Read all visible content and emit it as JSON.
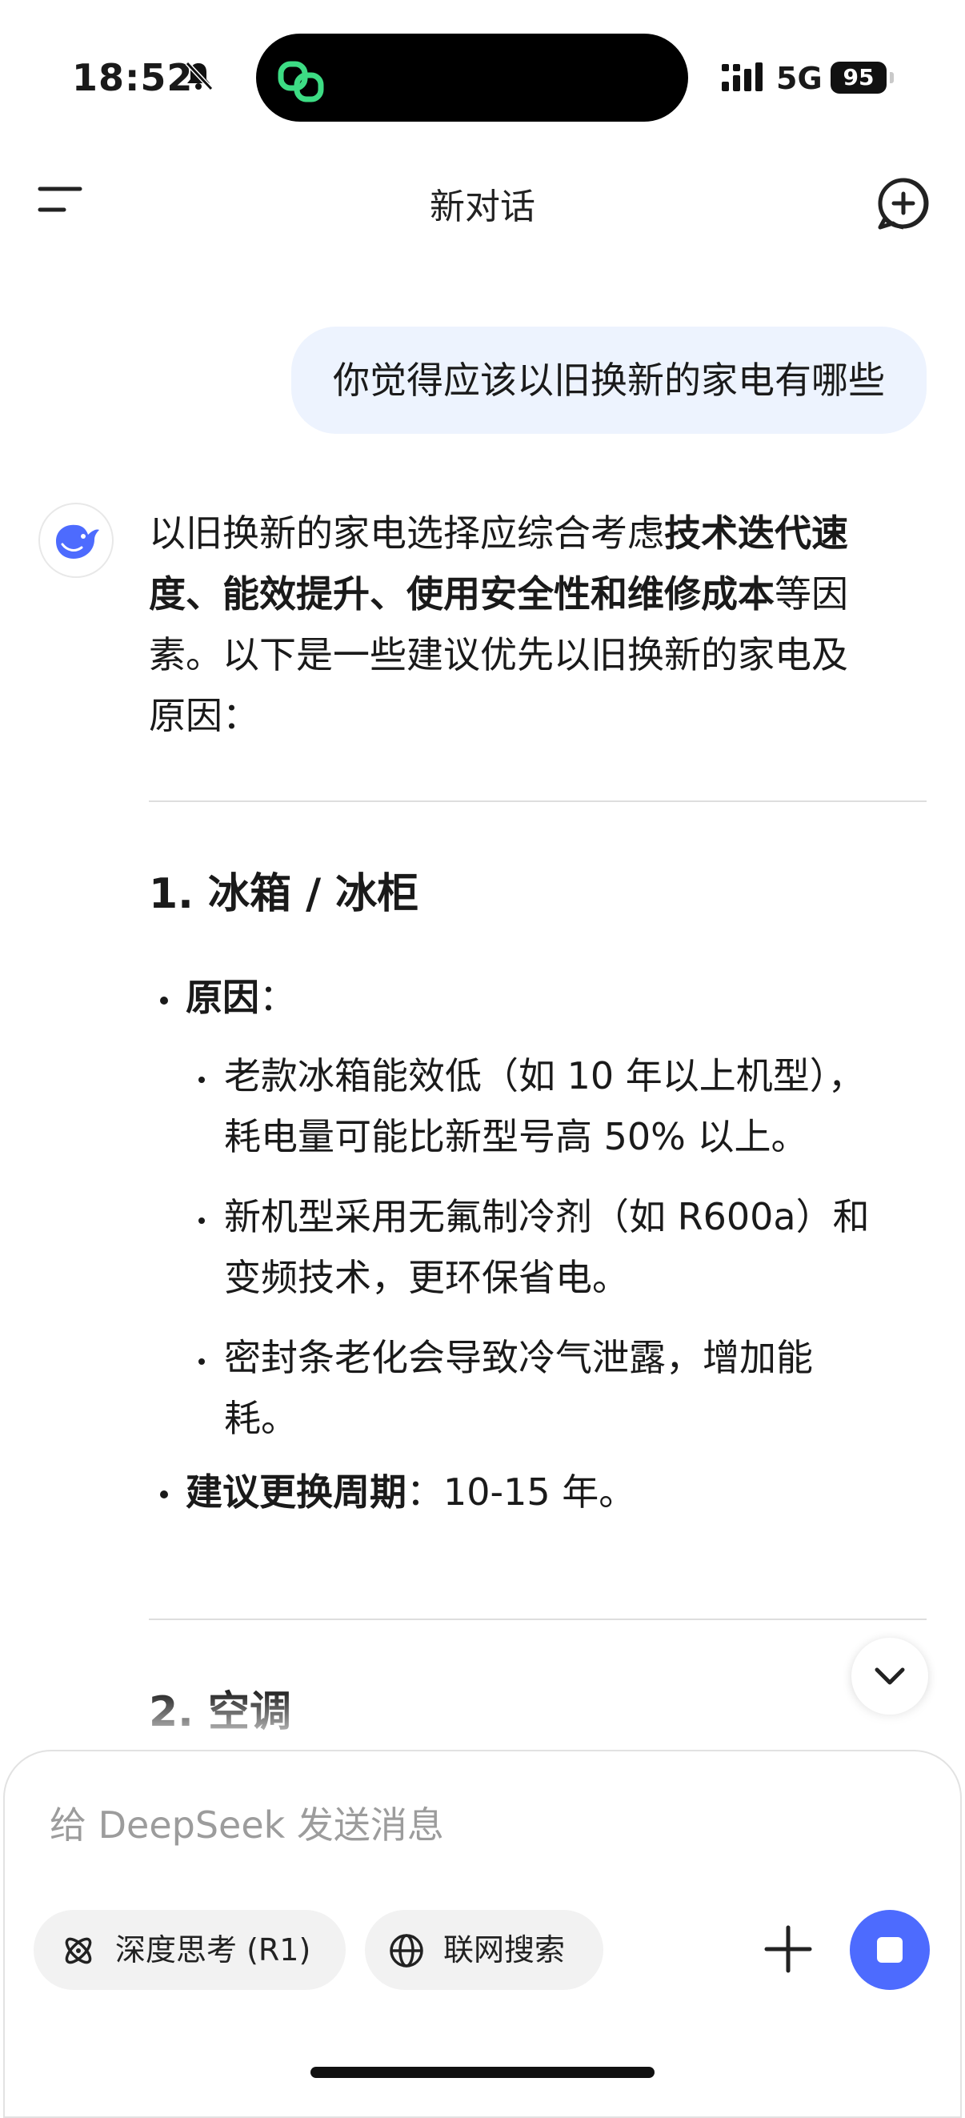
{
  "status_bar": {
    "time": "18:52",
    "network": "5G",
    "battery": "95",
    "icons": [
      "bell-slash-icon",
      "dynamic-island-app-icon",
      "signal-icon"
    ]
  },
  "header": {
    "title": "新对话",
    "menu_icon": "menu-icon",
    "new_chat_icon": "new-chat-icon"
  },
  "conversation": {
    "user_message": "你觉得应该以旧换新的家电有哪些",
    "assistant": {
      "intro": {
        "line1_a": "以旧换新的家电选择应综合考虑",
        "line1_b": "技术迭代速",
        "line2_a": "度、能效提升、使用安全性和维修成本",
        "line2_b": "等因",
        "line3": "素。以下是一些建议优先以旧换新的家电及",
        "line4": "原因："
      },
      "sections": [
        {
          "heading": "1. 冰箱 / 冰柜",
          "reason_label": "原因",
          "reason_colon": "：",
          "reasons": [
            {
              "line1": "老款冰箱能效低（如 10 年以上机型），",
              "line2": "耗电量可能比新型号高 50% 以上。"
            },
            {
              "line1": "新机型采用无氟制冷剂（如 R600a）和",
              "line2": "变频技术，更环保省电。"
            },
            {
              "line1": "密封条老化会导致冷气泄露，增加能",
              "line2": "耗。"
            }
          ],
          "cycle_label": "建议更换周期",
          "cycle_value": "：10-15 年。"
        },
        {
          "heading": "2. 空调"
        }
      ]
    }
  },
  "composer": {
    "placeholder": "给 DeepSeek 发送消息",
    "deep_think_label": "深度思考 (R1)",
    "web_search_label": "联网搜索"
  },
  "colors": {
    "accent": "#4d6bfe",
    "user_bubble": "#edf3fe",
    "text": "#1a1a1a",
    "placeholder": "#9c9c9c",
    "chip": "#f2f2f2",
    "island_icon": "#3ddc84"
  }
}
